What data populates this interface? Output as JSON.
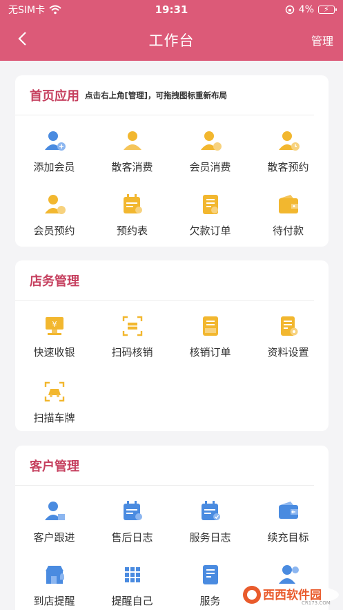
{
  "status": {
    "carrier": "无SIM卡",
    "time": "19:31",
    "battery": "4%"
  },
  "nav": {
    "title": "工作台",
    "manage": "管理"
  },
  "sections": [
    {
      "title": "首页应用",
      "hint": "点击右上角[管理]，可拖拽图标重新布局",
      "items": [
        {
          "label": "添加会员",
          "icon": "add-member-icon"
        },
        {
          "label": "散客消费",
          "icon": "guest-consume-icon"
        },
        {
          "label": "会员消费",
          "icon": "member-consume-icon"
        },
        {
          "label": "散客预约",
          "icon": "guest-booking-icon"
        },
        {
          "label": "会员预约",
          "icon": "member-booking-icon"
        },
        {
          "label": "预约表",
          "icon": "booking-table-icon"
        },
        {
          "label": "欠款订单",
          "icon": "debt-order-icon"
        },
        {
          "label": "待付款",
          "icon": "wallet-icon"
        }
      ]
    },
    {
      "title": "店务管理",
      "hint": "",
      "items": [
        {
          "label": "快速收银",
          "icon": "cashier-icon"
        },
        {
          "label": "扫码核销",
          "icon": "scan-icon"
        },
        {
          "label": "核销订单",
          "icon": "verify-order-icon"
        },
        {
          "label": "资料设置",
          "icon": "document-settings-icon"
        },
        {
          "label": "扫描车牌",
          "icon": "car-scan-icon"
        }
      ]
    },
    {
      "title": "客户管理",
      "hint": "",
      "items": [
        {
          "label": "客户跟进",
          "icon": "customer-followup-icon"
        },
        {
          "label": "售后日志",
          "icon": "aftersale-log-icon"
        },
        {
          "label": "服务日志",
          "icon": "service-log-icon"
        },
        {
          "label": "续充目标",
          "icon": "recharge-target-icon"
        },
        {
          "label": "到店提醒",
          "icon": "store-reminder-icon"
        },
        {
          "label": "提醒自己",
          "icon": "self-reminder-icon"
        },
        {
          "label": "服务",
          "icon": "service-icon"
        },
        {
          "label": "",
          "icon": "member-icon"
        }
      ]
    }
  ],
  "watermark": {
    "text": "西西软件园",
    "url": "CR173.COM"
  },
  "colors": {
    "primary": "#dc5a78",
    "title": "#c6405f",
    "gold": "#f2b72f",
    "blue": "#4a8be0"
  }
}
